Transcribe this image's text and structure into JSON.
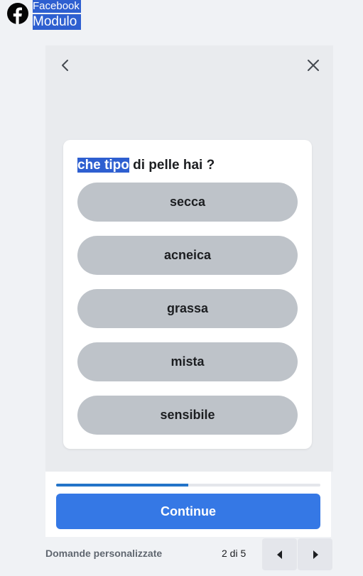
{
  "brand": {
    "name": "Facebook",
    "subtitle": "Modulo"
  },
  "form": {
    "question_highlight": "che tipo",
    "question_rest": " di pelle hai ?",
    "options": [
      {
        "label": "secca"
      },
      {
        "label": "acneica"
      },
      {
        "label": "grassa"
      },
      {
        "label": "mista"
      },
      {
        "label": "sensibile"
      }
    ],
    "progress_fraction": 0.5,
    "continue_label": "Continue"
  },
  "footer": {
    "label": "Domande personalizzate",
    "page_count": "2 di 5"
  },
  "icons": {
    "logo": "facebook-logo-icon",
    "back": "chevron-left-icon",
    "close": "close-icon",
    "prev": "caret-left-icon",
    "next": "caret-right-icon"
  },
  "colors": {
    "accent": "#3578e5",
    "progress": "#2374c9",
    "highlight": "#2e5fd0",
    "option_bg": "#bec3c9"
  }
}
